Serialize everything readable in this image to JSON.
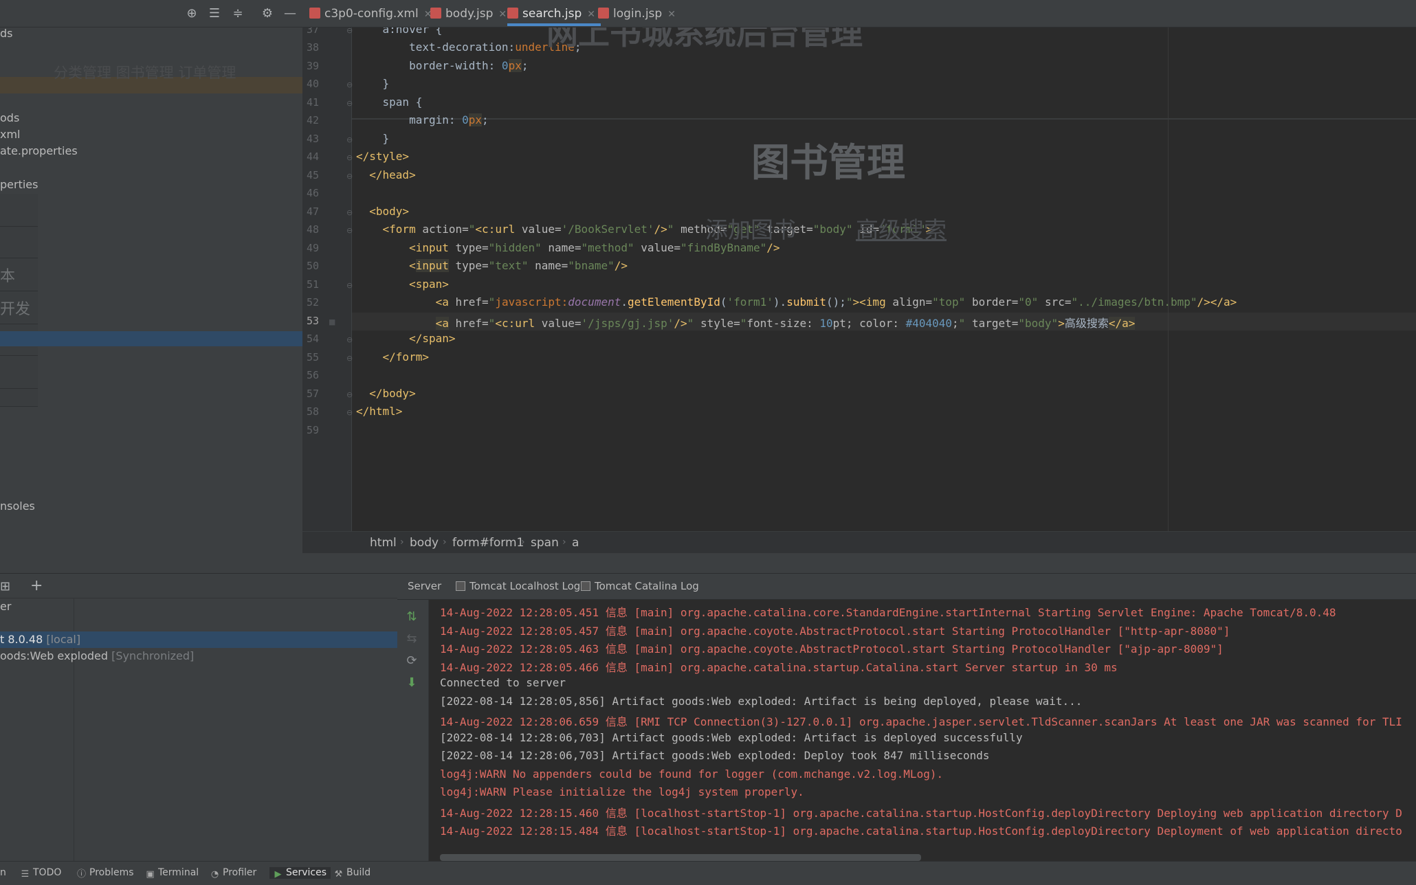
{
  "toolbar": {
    "tabs": [
      {
        "label": "c3p0-config.xml",
        "active": false
      },
      {
        "label": "body.jsp",
        "active": false
      },
      {
        "label": "search.jsp",
        "active": true
      },
      {
        "label": "login.jsp",
        "active": false
      }
    ],
    "icons": [
      "locate-icon",
      "expand-all-icon",
      "collapse-all-icon",
      "gear-icon",
      "minimize-icon"
    ]
  },
  "project_panel": {
    "items": [
      "ds",
      "ods",
      "xml",
      "ate.properties",
      "perties",
      "本",
      "开发",
      "nsoles"
    ],
    "overlay_nav": "分类管理  图书管理  订单管理"
  },
  "preview_overlay": {
    "site_title": "网上书城系统后台管理",
    "page_heading": "图书管理",
    "link_add": "添加图书",
    "link_search": "高级搜索"
  },
  "editor": {
    "line_numbers": [
      "37",
      "38",
      "39",
      "40",
      "41",
      "42",
      "43",
      "44",
      "45",
      "46",
      "47",
      "48",
      "49",
      "50",
      "51",
      "52",
      "53",
      "54",
      "55",
      "56",
      "57",
      "58",
      "59"
    ],
    "current_line": "53"
  },
  "breadcrumb": [
    "html",
    "body",
    "form#form1",
    "span",
    "a"
  ],
  "services": {
    "header_label": "er",
    "tomcat_name": "t 8.0.48",
    "tomcat_suffix": "[local]",
    "artifact_name": "oods:Web exploded",
    "artifact_suffix": "[Synchronized]"
  },
  "console": {
    "tabs": [
      "Server",
      "Tomcat Localhost Log",
      "Tomcat Catalina Log"
    ],
    "lines": [
      {
        "text": "14-Aug-2022 12:28:05.451 信息 [main] org.apache.catalina.core.StandardEngine.startInternal Starting Servlet Engine: Apache Tomcat/8.0.48",
        "level": "red"
      },
      {
        "text": "14-Aug-2022 12:28:05.457 信息 [main] org.apache.coyote.AbstractProtocol.start Starting ProtocolHandler [\"http-apr-8080\"]",
        "level": "red"
      },
      {
        "text": "14-Aug-2022 12:28:05.463 信息 [main] org.apache.coyote.AbstractProtocol.start Starting ProtocolHandler [\"ajp-apr-8009\"]",
        "level": "red"
      },
      {
        "text": "14-Aug-2022 12:28:05.466 信息 [main] org.apache.catalina.startup.Catalina.start Server startup in 30 ms",
        "level": "red"
      },
      {
        "text": "Connected to server",
        "level": "plain"
      },
      {
        "text": "[2022-08-14 12:28:05,856] Artifact goods:Web exploded: Artifact is being deployed, please wait...",
        "level": "plain"
      },
      {
        "text": "14-Aug-2022 12:28:06.659 信息 [RMI TCP Connection(3)-127.0.0.1] org.apache.jasper.servlet.TldScanner.scanJars At least one JAR was scanned for TLI",
        "level": "red"
      },
      {
        "text": "[2022-08-14 12:28:06,703] Artifact goods:Web exploded: Artifact is deployed successfully",
        "level": "plain"
      },
      {
        "text": "[2022-08-14 12:28:06,703] Artifact goods:Web exploded: Deploy took 847 milliseconds",
        "level": "plain"
      },
      {
        "text": "log4j:WARN No appenders could be found for logger (com.mchange.v2.log.MLog).",
        "level": "red"
      },
      {
        "text": "log4j:WARN Please initialize the log4j system properly.",
        "level": "red"
      },
      {
        "text": "14-Aug-2022 12:28:15.460 信息 [localhost-startStop-1] org.apache.catalina.startup.HostConfig.deployDirectory Deploying web application directory D",
        "level": "red"
      },
      {
        "text": "14-Aug-2022 12:28:15.484 信息 [localhost-startStop-1] org.apache.catalina.startup.HostConfig.deployDirectory Deployment of web application directo",
        "level": "red"
      }
    ]
  },
  "status_bar": {
    "items": [
      "TODO",
      "Problems",
      "Terminal",
      "Profiler",
      "Services",
      "Build"
    ],
    "left_fragment": "n",
    "active": "Services"
  },
  "colors": {
    "accent": "#4a88c7",
    "selection": "#2f4a66",
    "error_text": "#e06c63",
    "editor_bg": "#2b2b2b",
    "panel_bg": "#3c3f41"
  }
}
